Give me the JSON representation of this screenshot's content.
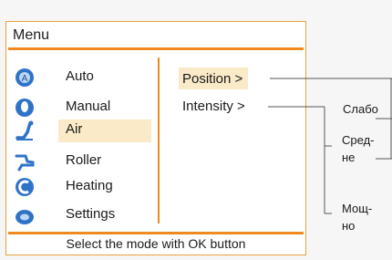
{
  "menu": {
    "title": "Menu",
    "items": [
      {
        "label": "Auto",
        "icon": "auto-mode-icon"
      },
      {
        "label": "Manual",
        "icon": "manual-mode-icon"
      },
      {
        "label": "Air",
        "icon": "air-massage-icon",
        "selected": true
      },
      {
        "label": "Roller",
        "icon": "roller-icon"
      },
      {
        "label": "Heating",
        "icon": "heating-icon"
      },
      {
        "label": "Settings",
        "icon": "settings-icon"
      }
    ],
    "submenu": {
      "position": "Position >",
      "intensity": "Intensity >"
    },
    "footer": "Select the mode with OK button"
  },
  "callouts": {
    "intensity_options": [
      "Слабо",
      "Сред-\nне",
      "Мощ-\nно"
    ]
  },
  "colors": {
    "accent": "#f08a1f",
    "highlight": "#faeac7",
    "icon_blue": "#2f73c9"
  }
}
